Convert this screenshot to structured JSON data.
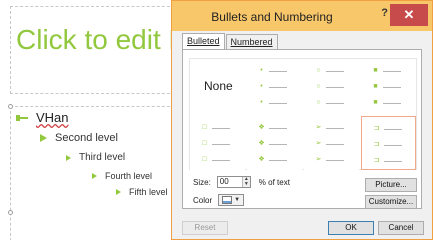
{
  "slide": {
    "title_placeholder": "Click to edit M",
    "levels": [
      {
        "key": "l1",
        "text": "VHan"
      },
      {
        "key": "l2",
        "text": "Second level"
      },
      {
        "key": "l3",
        "text": "Third level"
      },
      {
        "key": "l4",
        "text": "Fourth level"
      },
      {
        "key": "l5",
        "text": "Fifth level"
      }
    ]
  },
  "dialog": {
    "title": "Bullets and Numbering",
    "help_glyph": "?",
    "close_glyph": "✕",
    "tabs": [
      {
        "label": "Bulleted",
        "active": true
      },
      {
        "label": "Numbered",
        "active": false
      }
    ],
    "bullet_styles": [
      {
        "name": "None"
      },
      {
        "name": "small-dots"
      },
      {
        "name": "hollow-circles"
      },
      {
        "name": "filled-squares"
      },
      {
        "name": "hollow-squares"
      },
      {
        "name": "four-diamonds"
      },
      {
        "name": "arrowheads"
      },
      {
        "name": "arrow-bullets"
      }
    ],
    "none_label": "None",
    "size_label": "Size:",
    "size_value": "00",
    "size_suffix": "% of text",
    "color_label": "Color",
    "picture_button": "Picture...",
    "customize_button": "Customize...",
    "reset_button": "Reset",
    "ok_button": "OK",
    "cancel_button": "Cancel"
  },
  "colors": {
    "accent_green": "#92c83e",
    "title_bar": "#f8c76a",
    "selection": "#f2a98a"
  }
}
